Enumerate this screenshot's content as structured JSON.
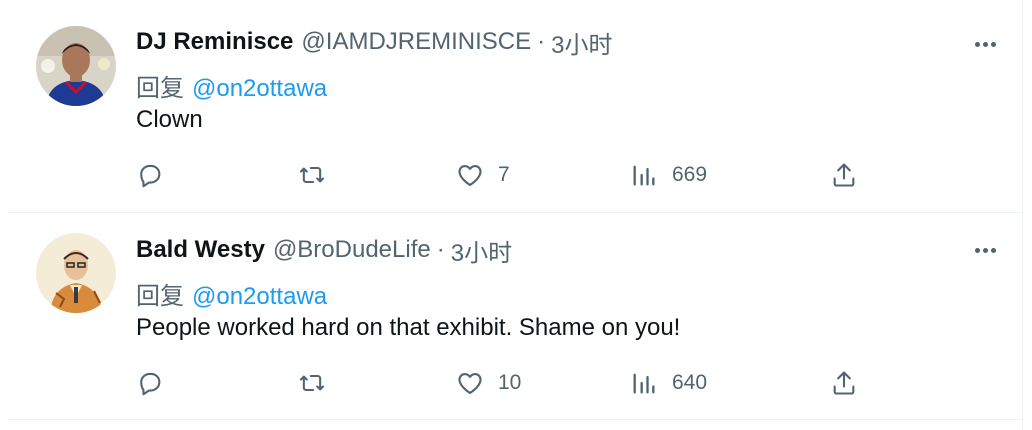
{
  "colors": {
    "text": "#0f1419",
    "secondary": "#536471",
    "link": "#1d9bf0",
    "divider": "#eff3f4"
  },
  "tweets": [
    {
      "name": "DJ Reminisce",
      "handle": "@IAMDJREMINISCE",
      "separator": "·",
      "time": "3小时",
      "reply_label": "回复",
      "reply_to": "@on2ottawa",
      "text": "Clown",
      "likes": "7",
      "views": "669"
    },
    {
      "name": "Bald Westy",
      "handle": "@BroDudeLife",
      "separator": "·",
      "time": "3小时",
      "reply_label": "回复",
      "reply_to": "@on2ottawa",
      "text": "People worked hard on that exhibit. Shame on you!",
      "likes": "10",
      "views": "640"
    }
  ],
  "icons": {
    "reply": "reply-bubble-icon",
    "retweet": "retweet-icon",
    "like": "heart-icon",
    "views": "views-chart-icon",
    "share": "share-upload-icon",
    "more": "more-dots-icon"
  }
}
